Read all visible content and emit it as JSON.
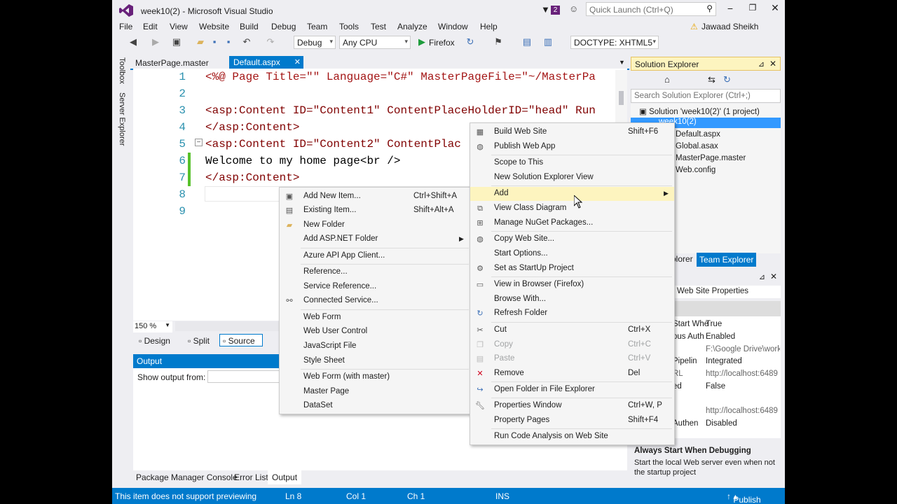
{
  "window": {
    "title": "week10(2) - Microsoft Visual Studio",
    "notifications": "2",
    "quick_launch_placeholder": "Quick Launch (Ctrl+Q)",
    "user": "Jawaad Sheikh"
  },
  "menu": [
    "File",
    "Edit",
    "View",
    "Website",
    "Build",
    "Debug",
    "Team",
    "Tools",
    "Test",
    "Analyze",
    "Window",
    "Help"
  ],
  "toolbar": {
    "config": "Debug",
    "platform": "Any CPU",
    "browser": "Firefox",
    "doctype": "DOCTYPE: XHTML5"
  },
  "side_tabs": [
    "Toolbox",
    "Server Explorer"
  ],
  "doc_tabs": [
    {
      "label": "MasterPage.master"
    },
    {
      "label": "Default.aspx"
    }
  ],
  "editor": {
    "lines": [
      {
        "num": "1",
        "text": "<%@ Page Title=\"\" Language=\"C#\" MasterPageFile=\"~/MasterPa"
      },
      {
        "num": "2",
        "text": ""
      },
      {
        "num": "3",
        "text": "<asp:Content ID=\"Content1\" ContentPlaceHolderID=\"head\" Run"
      },
      {
        "num": "4",
        "text": "</asp:Content>"
      },
      {
        "num": "5",
        "text": "<asp:Content ID=\"Content2\" ContentPlac"
      },
      {
        "num": "6",
        "text": "Welcome to my home page<br />"
      },
      {
        "num": "7",
        "text": "</asp:Content>"
      },
      {
        "num": "8",
        "text": ""
      },
      {
        "num": "9",
        "text": ""
      }
    ],
    "zoom": "150 %",
    "view_tabs": [
      "Design",
      "Split",
      "Source"
    ]
  },
  "output": {
    "title": "Output",
    "show_from_label": "Show output from:"
  },
  "bottom_tabs": [
    "Package Manager Console",
    "Error List",
    "Output"
  ],
  "solution_explorer": {
    "title": "Solution Explorer",
    "search_placeholder": "Search Solution Explorer (Ctrl+;)",
    "items": [
      {
        "label": "Solution 'week10(2)' (1 project)"
      },
      {
        "label": "week10(2)"
      },
      {
        "label": "Default.aspx"
      },
      {
        "label": "Global.asax"
      },
      {
        "label": "MasterPage.master"
      },
      {
        "label": "Web.config"
      }
    ],
    "tabs": [
      "olorer",
      "Team Explorer"
    ]
  },
  "properties": {
    "object": "Web Site Properties",
    "rows": [
      {
        "name": "Start Whe",
        "value": "True"
      },
      {
        "name": "ous Auth",
        "value": "Enabled"
      },
      {
        "name": "",
        "value": "F:\\Google Drive\\work"
      },
      {
        "name": "Pipelin",
        "value": "Integrated"
      },
      {
        "name": "RL",
        "value": "http://localhost:6489"
      },
      {
        "name": "ed",
        "value": "False"
      },
      {
        "name": "",
        "value": ""
      },
      {
        "name": "",
        "value": "http://localhost:6489"
      },
      {
        "name": "Authen",
        "value": "Disabled"
      }
    ],
    "desc_title": "Always Start When Debugging",
    "desc_text": "Start the local Web server even when not the startup project"
  },
  "context_menu": {
    "items": [
      {
        "label": "Build Web Site",
        "shortcut": "Shift+F6",
        "icon": "build-icon"
      },
      {
        "label": "Publish Web App",
        "shortcut": "",
        "icon": "globe-icon"
      },
      {
        "label": "Scope to This",
        "shortcut": "",
        "icon": ""
      },
      {
        "label": "New Solution Explorer View",
        "shortcut": "",
        "icon": ""
      },
      {
        "label": "Add",
        "shortcut": "",
        "icon": ""
      },
      {
        "label": "View Class Diagram",
        "shortcut": "",
        "icon": "class-diagram-icon"
      },
      {
        "label": "Manage NuGet Packages...",
        "shortcut": "",
        "icon": "nuget-icon"
      },
      {
        "label": "Copy Web Site...",
        "shortcut": "",
        "icon": "copy-web-icon"
      },
      {
        "label": "Start Options...",
        "shortcut": "",
        "icon": ""
      },
      {
        "label": "Set as StartUp Project",
        "shortcut": "",
        "icon": "gear-icon"
      },
      {
        "label": "View in Browser (Firefox)",
        "shortcut": "",
        "icon": "browser-icon"
      },
      {
        "label": "Browse With...",
        "shortcut": "",
        "icon": ""
      },
      {
        "label": "Refresh Folder",
        "shortcut": "",
        "icon": "refresh-icon"
      },
      {
        "label": "Cut",
        "shortcut": "Ctrl+X",
        "icon": "scissors-icon"
      },
      {
        "label": "Copy",
        "shortcut": "Ctrl+C",
        "icon": "copy-icon"
      },
      {
        "label": "Paste",
        "shortcut": "Ctrl+V",
        "icon": "paste-icon"
      },
      {
        "label": "Remove",
        "shortcut": "Del",
        "icon": "remove-icon"
      },
      {
        "label": "Open Folder in File Explorer",
        "shortcut": "",
        "icon": "open-folder-icon"
      },
      {
        "label": "Properties Window",
        "shortcut": "Ctrl+W, P",
        "icon": "wrench-icon"
      },
      {
        "label": "Property Pages",
        "shortcut": "Shift+F4",
        "icon": ""
      },
      {
        "label": "Run Code Analysis on Web Site",
        "shortcut": "",
        "icon": ""
      }
    ]
  },
  "add_submenu": {
    "items": [
      {
        "label": "Add New Item...",
        "shortcut": "Ctrl+Shift+A"
      },
      {
        "label": "Existing Item...",
        "shortcut": "Shift+Alt+A"
      },
      {
        "label": "New Folder",
        "shortcut": ""
      },
      {
        "label": "Add ASP.NET Folder",
        "shortcut": ""
      },
      {
        "label": "Azure API App Client...",
        "shortcut": ""
      },
      {
        "label": "Reference...",
        "shortcut": ""
      },
      {
        "label": "Service Reference...",
        "shortcut": ""
      },
      {
        "label": "Connected Service...",
        "shortcut": ""
      },
      {
        "label": "Web Form",
        "shortcut": ""
      },
      {
        "label": "Web User Control",
        "shortcut": ""
      },
      {
        "label": "JavaScript File",
        "shortcut": ""
      },
      {
        "label": "Style Sheet",
        "shortcut": ""
      },
      {
        "label": "Web Form (with master)",
        "shortcut": ""
      },
      {
        "label": "Master Page",
        "shortcut": ""
      },
      {
        "label": "DataSet",
        "shortcut": ""
      }
    ]
  },
  "status": {
    "message": "This item does not support previewing",
    "ln": "Ln 8",
    "col": "Col 1",
    "ch": "Ch 1",
    "mode": "INS",
    "publish": "Publish"
  }
}
